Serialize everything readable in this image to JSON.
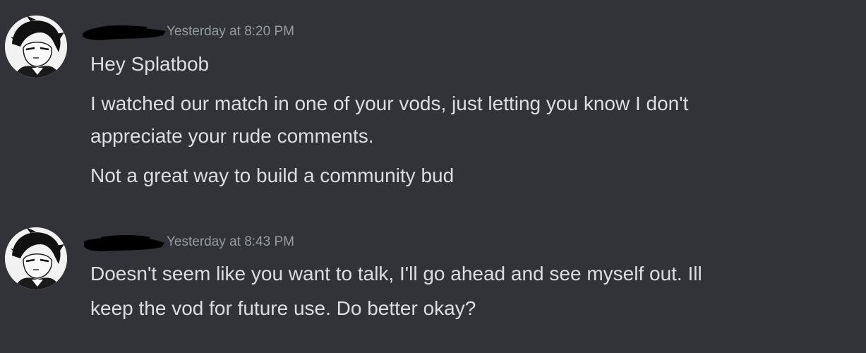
{
  "messages": [
    {
      "timestamp": "Yesterday at 8:20 PM",
      "lines": [
        "Hey Splatbob",
        "I watched our match in one of your vods, just letting you know I don't",
        "appreciate your rude comments.",
        "Not a great way to build a community bud"
      ]
    },
    {
      "timestamp": "Yesterday at 8:43 PM",
      "lines": [
        "Doesn't seem like you want to talk, I'll go ahead and see myself out. Ill",
        "keep the vod for future use. Do better okay?"
      ]
    }
  ],
  "colors": {
    "background": "#313338",
    "text": "#dbdee1",
    "timestamp": "#949ba4",
    "redaction": "#000000"
  }
}
